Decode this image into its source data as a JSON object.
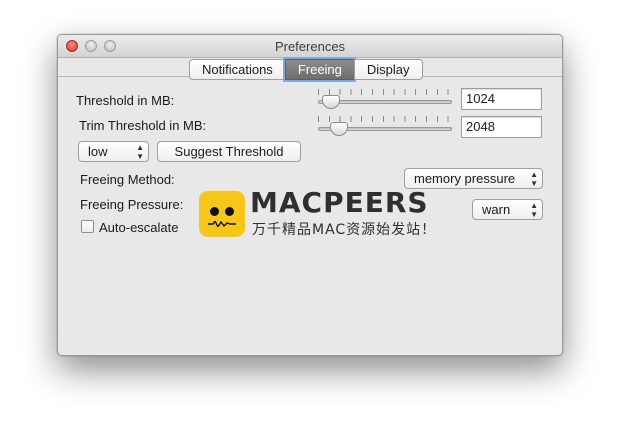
{
  "window": {
    "title": "Preferences"
  },
  "tabs": [
    {
      "label": "Notifications",
      "selected": false
    },
    {
      "label": "Freeing",
      "selected": true
    },
    {
      "label": "Display",
      "selected": false
    }
  ],
  "threshold": {
    "label": "Threshold in MB:",
    "value": "1024"
  },
  "trim_threshold": {
    "label": "Trim Threshold in MB:",
    "value": "2048"
  },
  "level_popup": {
    "value": "low"
  },
  "suggest_button": {
    "label": "Suggest Threshold"
  },
  "freeing_method": {
    "label": "Freeing Method:",
    "value": "memory pressure"
  },
  "freeing_pressure": {
    "label": "Freeing Pressure:",
    "value": "warn"
  },
  "auto_escalate": {
    "label": "Auto-escalate",
    "checked": false
  },
  "watermark": {
    "title": "MACPEERS",
    "subtitle": "万千精品MAC资源始发站！"
  },
  "colors": {
    "selected_tab": "#7a7a7a",
    "focus_ring": "#7ea9e0",
    "logo": "#f7c718"
  },
  "icons": {
    "close": "close-button",
    "minimize": "minimize-button",
    "zoom": "zoom-button",
    "popup": "up-down-arrows-icon"
  }
}
